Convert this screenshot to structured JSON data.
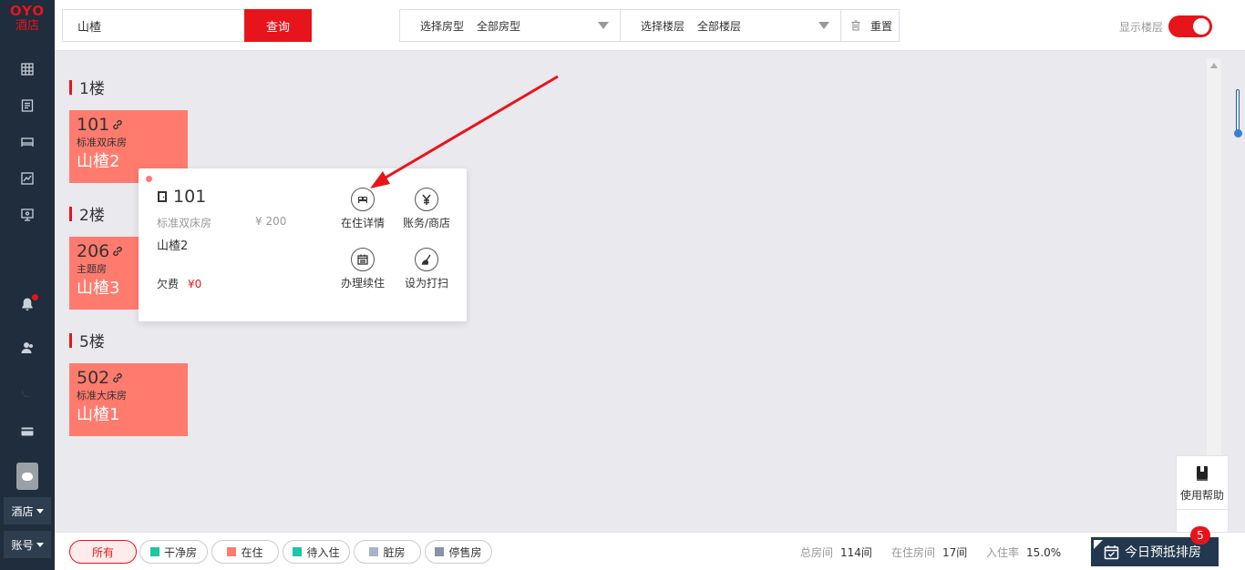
{
  "brand": {
    "logo": "OYO",
    "sub": "酒店"
  },
  "sidebar": {
    "icons": [
      "grid-icon",
      "list-icon",
      "bed-icon",
      "chart-icon",
      "monitor-icon",
      "bell-icon",
      "users-icon",
      "moon-icon",
      "card-icon"
    ],
    "hotel_label": "酒店",
    "account_label": "账号"
  },
  "search": {
    "value": "山楂",
    "button": "查询"
  },
  "filters": {
    "room_type_label": "选择房型",
    "room_type_value": "全部房型",
    "floor_label": "选择楼层",
    "floor_value": "全部楼层",
    "reset_label": "重置"
  },
  "toggle": {
    "label": "显示楼层",
    "on": true
  },
  "floors": [
    {
      "title": "1楼",
      "rooms": [
        {
          "no": "101",
          "type": "标准双床房",
          "guest": "山楂2"
        }
      ]
    },
    {
      "title": "2楼",
      "rooms": [
        {
          "no": "206",
          "type": "主题房",
          "guest": "山楂3"
        }
      ]
    },
    {
      "title": "5楼",
      "rooms": [
        {
          "no": "502",
          "type": "标准大床房",
          "guest": "山楂1"
        }
      ]
    }
  ],
  "popup": {
    "room_no": "101",
    "room_type": "标准双床房",
    "price": "¥ 200",
    "guest": "山楂2",
    "owe_label": "欠费",
    "owe_amount": "¥0",
    "actions": [
      "在住详情",
      "账务/商店",
      "办理续住",
      "设为打扫"
    ]
  },
  "help": {
    "label": "使用帮助"
  },
  "status_filters": [
    {
      "label": "所有",
      "color": null,
      "active": true
    },
    {
      "label": "干净房",
      "color": "#1dc7a0"
    },
    {
      "label": "在住",
      "color": "#ff7b6e"
    },
    {
      "label": "待入住",
      "color": "#1dc7a0"
    },
    {
      "label": "脏房",
      "color": "#a9b4c8"
    },
    {
      "label": "停售房",
      "color": "#8893a3"
    }
  ],
  "stats": {
    "total_label": "总房间",
    "total_value": "114间",
    "occupied_label": "在住房间",
    "occupied_value": "17间",
    "rate_label": "入住率",
    "rate_value": "15.0%"
  },
  "today_button": {
    "label": "今日预抵排房",
    "badge": "5"
  },
  "colors": {
    "accent": "#e8141b",
    "occupied": "#ff7b6e",
    "sidebar": "#1f2d3d"
  }
}
